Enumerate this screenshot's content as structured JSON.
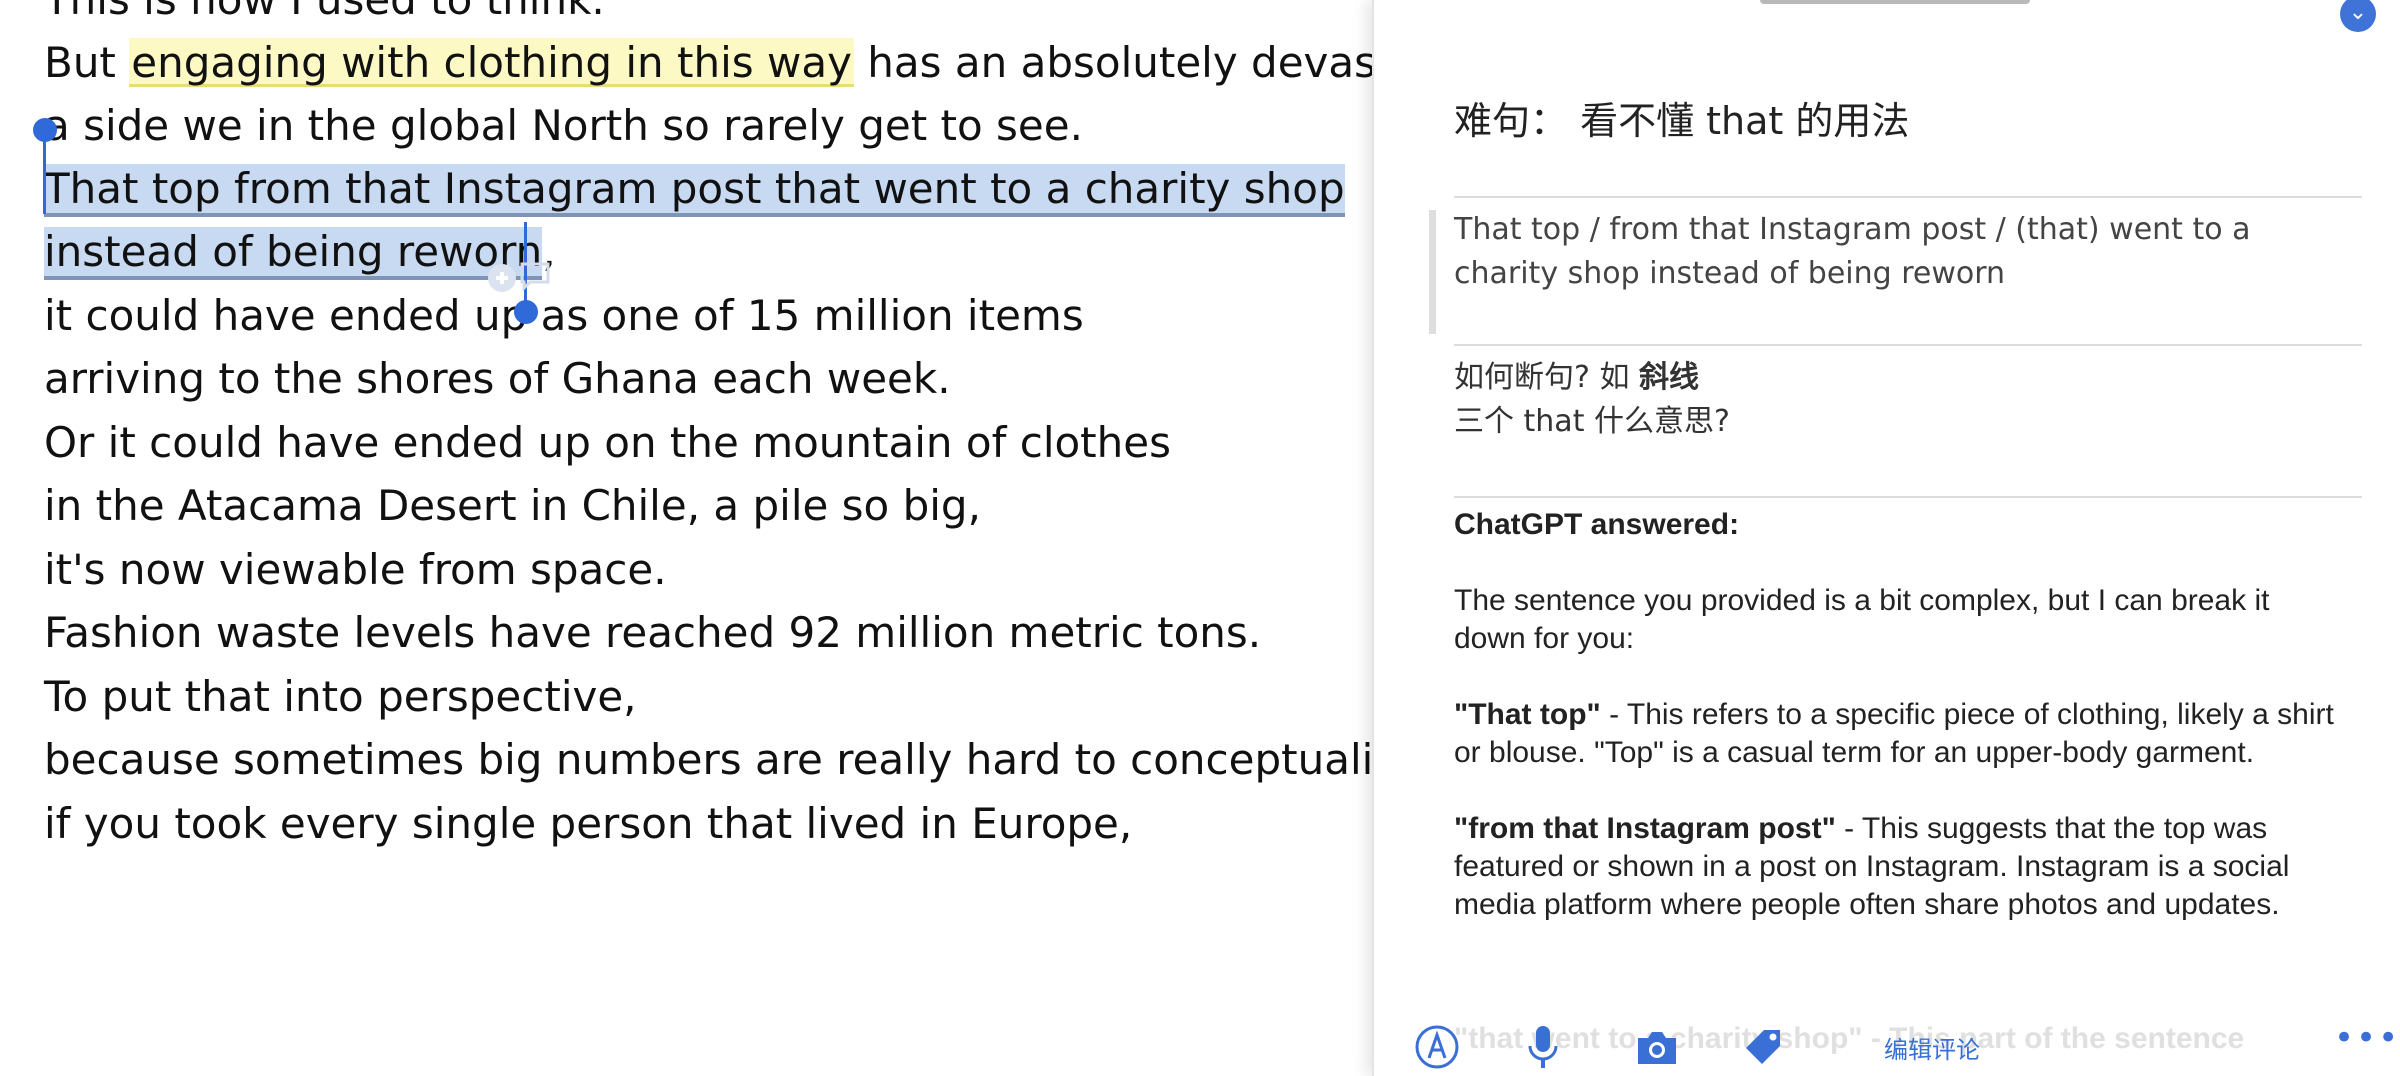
{
  "reader": {
    "lines": [
      "This is how I used to think.",
      "But ",
      "engaging with clothing in this way",
      " has an absolutely devastating",
      "a side we in the global North so rarely get to see.",
      "That top from that Instagram post that went to a charity shop",
      "instead of being reworn",
      ",",
      "it could have ended up as one of 15 million items",
      "arriving to the shores of Ghana each week.",
      "Or it could have ended up on the mountain of clothes",
      "in the Atacama Desert in Chile, a pile so big,",
      "it's now viewable from space.",
      "Fashion waste levels have reached 92 million metric tons.",
      "To put that into perspective,",
      "because sometimes big numbers are really hard to conceptualize,",
      "if you took every single person that lived in Europe,"
    ],
    "colors": {
      "yellow_highlight": "#fdf9c4",
      "blue_selection": "#c8d9f2",
      "handle": "#2f6ad8"
    }
  },
  "panel": {
    "title": "难句：  看不懂 that 的用法",
    "quote": "That top / from that Instagram post / (that) went to a charity shop instead of being reworn",
    "note_line1_prefix": "如何断句?   如 ",
    "note_line1_bold": "斜线",
    "note_line2": "三个 that 什么意思?",
    "answer": {
      "heading": "ChatGPT answered:",
      "intro": "The sentence you provided is a bit complex, but I can break it down for you:",
      "item1_term": "\"That top\"",
      "item1_text": " - This refers to a specific piece of clothing, likely a shirt or blouse. \"Top\" is a casual term for an upper-body garment.",
      "item2_term": "\"from that Instagram post\"",
      "item2_text": " - This suggests that the top was featured or shown in a post on Instagram. Instagram is a social media platform where people often share photos and updates."
    },
    "toolbar": {
      "faded_text": "\"that went to a charity shop\" - This part of the sentence",
      "edit_comment": "编辑评论",
      "more": "•••"
    },
    "accent": "#3a6fd6"
  }
}
